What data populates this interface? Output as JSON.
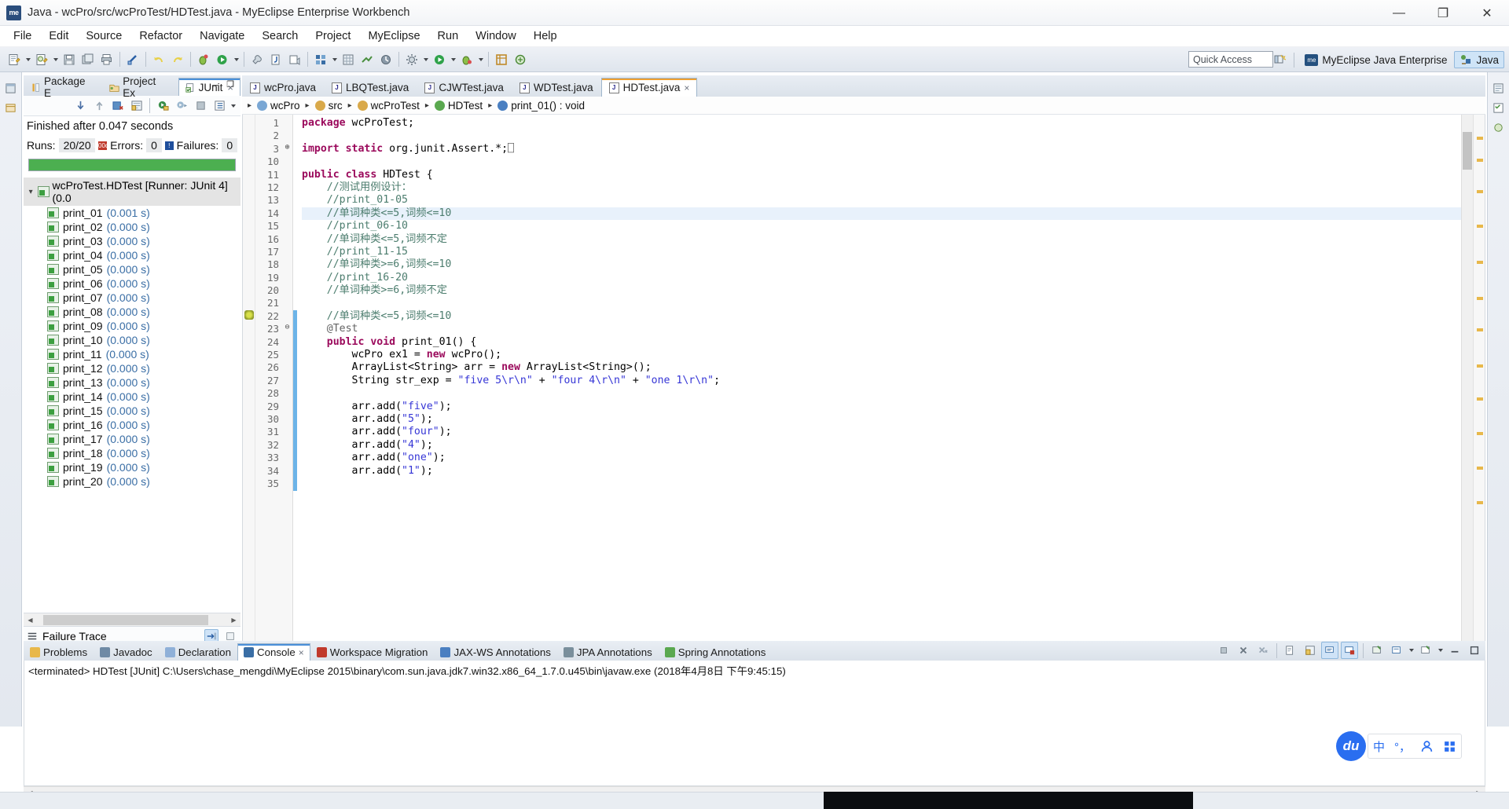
{
  "window": {
    "title": "Java - wcPro/src/wcProTest/HDTest.java - MyEclipse Enterprise Workbench",
    "app_badge": "me",
    "minimize": "—",
    "maximize": "❐",
    "close": "✕"
  },
  "menubar": {
    "items": [
      "File",
      "Edit",
      "Source",
      "Refactor",
      "Navigate",
      "Search",
      "Project",
      "MyEclipse",
      "Run",
      "Window",
      "Help"
    ]
  },
  "toolbar": {
    "quick_access_placeholder": "Quick Access",
    "quick_access_value": "Quick Access",
    "perspectives": [
      {
        "label": "MyEclipse Java Enterprise",
        "active": false,
        "icon": "myeclipse-icon"
      },
      {
        "label": "Java",
        "active": true,
        "icon": "java-perspective-icon"
      }
    ]
  },
  "junit": {
    "tabs": [
      {
        "label": "Package E",
        "icon": "package-explorer-icon",
        "active": false
      },
      {
        "label": "Project Ex",
        "icon": "project-explorer-icon",
        "active": false
      },
      {
        "label": "JUnit",
        "icon": "junit-icon",
        "active": true
      }
    ],
    "close_glyph": "×",
    "minimize_glyph": "–",
    "maximize_glyph": "❐",
    "status": "Finished after 0.047 seconds",
    "counts": {
      "runs_label": "Runs:",
      "runs_value": "20/20",
      "errors_label": "Errors:",
      "errors_value": "0",
      "failures_label": "Failures:",
      "failures_value": "0"
    },
    "progress_percent": 100,
    "progress_color": "#4caf50",
    "root": "wcProTest.HDTest [Runner: JUnit 4] (0.0",
    "tests": [
      {
        "name": "print_01",
        "time": "(0.001 s)"
      },
      {
        "name": "print_02",
        "time": "(0.000 s)"
      },
      {
        "name": "print_03",
        "time": "(0.000 s)"
      },
      {
        "name": "print_04",
        "time": "(0.000 s)"
      },
      {
        "name": "print_05",
        "time": "(0.000 s)"
      },
      {
        "name": "print_06",
        "time": "(0.000 s)"
      },
      {
        "name": "print_07",
        "time": "(0.000 s)"
      },
      {
        "name": "print_08",
        "time": "(0.000 s)"
      },
      {
        "name": "print_09",
        "time": "(0.000 s)"
      },
      {
        "name": "print_10",
        "time": "(0.000 s)"
      },
      {
        "name": "print_11",
        "time": "(0.000 s)"
      },
      {
        "name": "print_12",
        "time": "(0.000 s)"
      },
      {
        "name": "print_13",
        "time": "(0.000 s)"
      },
      {
        "name": "print_14",
        "time": "(0.000 s)"
      },
      {
        "name": "print_15",
        "time": "(0.000 s)"
      },
      {
        "name": "print_16",
        "time": "(0.000 s)"
      },
      {
        "name": "print_17",
        "time": "(0.000 s)"
      },
      {
        "name": "print_18",
        "time": "(0.000 s)"
      },
      {
        "name": "print_19",
        "time": "(0.000 s)"
      },
      {
        "name": "print_20",
        "time": "(0.000 s)"
      }
    ],
    "failure_trace_label": "Failure Trace"
  },
  "editor": {
    "tabs": [
      {
        "label": "wcPro.java",
        "active": false
      },
      {
        "label": "LBQTest.java",
        "active": false
      },
      {
        "label": "CJWTest.java",
        "active": false
      },
      {
        "label": "WDTest.java",
        "active": false
      },
      {
        "label": "HDTest.java",
        "active": true
      }
    ],
    "tab_close_glyph": "×",
    "breadcrumb": [
      {
        "label": "wcPro",
        "icon": "project-icon"
      },
      {
        "label": "src",
        "icon": "source-folder-icon"
      },
      {
        "label": "wcProTest",
        "icon": "package-icon"
      },
      {
        "label": "HDTest",
        "icon": "class-icon"
      },
      {
        "label": "print_01() : void",
        "icon": "method-icon"
      }
    ],
    "breadcrumb_sep": "▸",
    "lines": [
      {
        "num": "1",
        "fold": "",
        "marker": "",
        "hl": false,
        "tokens": [
          {
            "t": "package ",
            "c": "kw"
          },
          {
            "t": "wcProTest;",
            "c": ""
          }
        ]
      },
      {
        "num": "2",
        "fold": "",
        "marker": "",
        "hl": false,
        "tokens": []
      },
      {
        "num": "3",
        "fold": "⊕",
        "marker": "",
        "hl": false,
        "tokens": [
          {
            "t": "import static ",
            "c": "kw"
          },
          {
            "t": "org.junit.Assert.*;",
            "c": ""
          },
          {
            "t": "⎕",
            "c": "ann"
          }
        ]
      },
      {
        "num": "10",
        "fold": "",
        "marker": "",
        "hl": false,
        "tokens": []
      },
      {
        "num": "11",
        "fold": "",
        "marker": "",
        "hl": false,
        "tokens": [
          {
            "t": "public class ",
            "c": "kw"
          },
          {
            "t": "HDTest {",
            "c": ""
          }
        ]
      },
      {
        "num": "12",
        "fold": "",
        "marker": "",
        "hl": false,
        "tokens": [
          {
            "t": "    //测试用例设计：",
            "c": "cm"
          }
        ]
      },
      {
        "num": "13",
        "fold": "",
        "marker": "",
        "hl": false,
        "tokens": [
          {
            "t": "    //print_01-05",
            "c": "cm"
          }
        ]
      },
      {
        "num": "14",
        "fold": "",
        "marker": "",
        "hl": true,
        "tokens": [
          {
            "t": "    //单词种类<=5,词频<=10",
            "c": "cm"
          }
        ]
      },
      {
        "num": "15",
        "fold": "",
        "marker": "",
        "hl": false,
        "tokens": [
          {
            "t": "    //print_06-10",
            "c": "cm"
          }
        ]
      },
      {
        "num": "16",
        "fold": "",
        "marker": "",
        "hl": false,
        "tokens": [
          {
            "t": "    //单词种类<=5,词频不定",
            "c": "cm"
          }
        ]
      },
      {
        "num": "17",
        "fold": "",
        "marker": "",
        "hl": false,
        "tokens": [
          {
            "t": "    //print_11-15",
            "c": "cm"
          }
        ]
      },
      {
        "num": "18",
        "fold": "",
        "marker": "",
        "hl": false,
        "tokens": [
          {
            "t": "    //单词种类>=6,词频<=10",
            "c": "cm"
          }
        ]
      },
      {
        "num": "19",
        "fold": "",
        "marker": "",
        "hl": false,
        "tokens": [
          {
            "t": "    //print_16-20",
            "c": "cm"
          }
        ]
      },
      {
        "num": "20",
        "fold": "",
        "marker": "",
        "hl": false,
        "tokens": [
          {
            "t": "    //单词种类>=6,词频不定",
            "c": "cm"
          }
        ]
      },
      {
        "num": "21",
        "fold": "",
        "marker": "",
        "hl": false,
        "tokens": []
      },
      {
        "num": "22",
        "fold": "",
        "marker": "bug",
        "hl": false,
        "tokens": [
          {
            "t": "    //单词种类<=5,词频<=10",
            "c": "cm"
          }
        ]
      },
      {
        "num": "23",
        "fold": "⊖",
        "marker": "",
        "hl": false,
        "tokens": [
          {
            "t": "    @Test",
            "c": "ann"
          }
        ]
      },
      {
        "num": "24",
        "fold": "",
        "marker": "",
        "hl": false,
        "tokens": [
          {
            "t": "    ",
            "c": ""
          },
          {
            "t": "public void ",
            "c": "kw"
          },
          {
            "t": "print_01() {",
            "c": ""
          }
        ]
      },
      {
        "num": "25",
        "fold": "",
        "marker": "",
        "hl": false,
        "tokens": [
          {
            "t": "        wcPro ex1 = ",
            "c": ""
          },
          {
            "t": "new ",
            "c": "kw"
          },
          {
            "t": "wcPro();",
            "c": ""
          }
        ]
      },
      {
        "num": "26",
        "fold": "",
        "marker": "",
        "hl": false,
        "tokens": [
          {
            "t": "        ArrayList<String> arr = ",
            "c": ""
          },
          {
            "t": "new ",
            "c": "kw"
          },
          {
            "t": "ArrayList<String>();",
            "c": ""
          }
        ]
      },
      {
        "num": "27",
        "fold": "",
        "marker": "",
        "hl": false,
        "tokens": [
          {
            "t": "        String str_exp = ",
            "c": ""
          },
          {
            "t": "\"five 5\\r\\n\"",
            "c": "str"
          },
          {
            "t": " + ",
            "c": ""
          },
          {
            "t": "\"four 4\\r\\n\"",
            "c": "str"
          },
          {
            "t": " + ",
            "c": ""
          },
          {
            "t": "\"one 1\\r\\n\"",
            "c": "str"
          },
          {
            "t": ";",
            "c": ""
          }
        ]
      },
      {
        "num": "28",
        "fold": "",
        "marker": "",
        "hl": false,
        "tokens": []
      },
      {
        "num": "29",
        "fold": "",
        "marker": "",
        "hl": false,
        "tokens": [
          {
            "t": "        arr.add(",
            "c": ""
          },
          {
            "t": "\"five\"",
            "c": "str"
          },
          {
            "t": ");",
            "c": ""
          }
        ]
      },
      {
        "num": "30",
        "fold": "",
        "marker": "",
        "hl": false,
        "tokens": [
          {
            "t": "        arr.add(",
            "c": ""
          },
          {
            "t": "\"5\"",
            "c": "str"
          },
          {
            "t": ");",
            "c": ""
          }
        ]
      },
      {
        "num": "31",
        "fold": "",
        "marker": "",
        "hl": false,
        "tokens": [
          {
            "t": "        arr.add(",
            "c": ""
          },
          {
            "t": "\"four\"",
            "c": "str"
          },
          {
            "t": ");",
            "c": ""
          }
        ]
      },
      {
        "num": "32",
        "fold": "",
        "marker": "",
        "hl": false,
        "tokens": [
          {
            "t": "        arr.add(",
            "c": ""
          },
          {
            "t": "\"4\"",
            "c": "str"
          },
          {
            "t": ");",
            "c": ""
          }
        ]
      },
      {
        "num": "33",
        "fold": "",
        "marker": "",
        "hl": false,
        "tokens": [
          {
            "t": "        arr.add(",
            "c": ""
          },
          {
            "t": "\"one\"",
            "c": "str"
          },
          {
            "t": ");",
            "c": ""
          }
        ]
      },
      {
        "num": "34",
        "fold": "",
        "marker": "",
        "hl": false,
        "tokens": [
          {
            "t": "        arr.add(",
            "c": ""
          },
          {
            "t": "\"1\"",
            "c": "str"
          },
          {
            "t": ");",
            "c": ""
          }
        ]
      },
      {
        "num": "35",
        "fold": "",
        "marker": "",
        "hl": false,
        "tokens": []
      }
    ]
  },
  "console": {
    "tabs": [
      {
        "label": "Problems",
        "icon": "problems-icon",
        "active": false
      },
      {
        "label": "Javadoc",
        "icon": "javadoc-icon",
        "active": false
      },
      {
        "label": "Declaration",
        "icon": "declaration-icon",
        "active": false
      },
      {
        "label": "Console",
        "icon": "console-icon",
        "active": true
      },
      {
        "label": "Workspace Migration",
        "icon": "migration-icon",
        "active": false
      },
      {
        "label": "JAX-WS Annotations",
        "icon": "jaxws-icon",
        "active": false
      },
      {
        "label": "JPA Annotations",
        "icon": "jpa-icon",
        "active": false
      },
      {
        "label": "Spring Annotations",
        "icon": "spring-icon",
        "active": false
      }
    ],
    "close_glyph": "×",
    "output": "<terminated> HDTest [JUnit] C:\\Users\\chase_mengdi\\MyEclipse 2015\\binary\\com.sun.java.jdk7.win32.x86_64_1.7.0.u45\\bin\\javaw.exe (2018年4月8日 下午9:45:15)"
  },
  "ime": {
    "logo": "du",
    "mode": "中",
    "punctuation": "°，",
    "user_icon": "user-icon",
    "apps_icon": "apps-grid-icon"
  },
  "colors": {
    "accent_blue": "#4a90d9",
    "editor_accent": "#f0a030",
    "progress_green": "#4caf50",
    "keyword": "#9b0a5c",
    "comment": "#4c7d6e",
    "string": "#3636d6",
    "highlight_line": "#e8f1fb"
  }
}
